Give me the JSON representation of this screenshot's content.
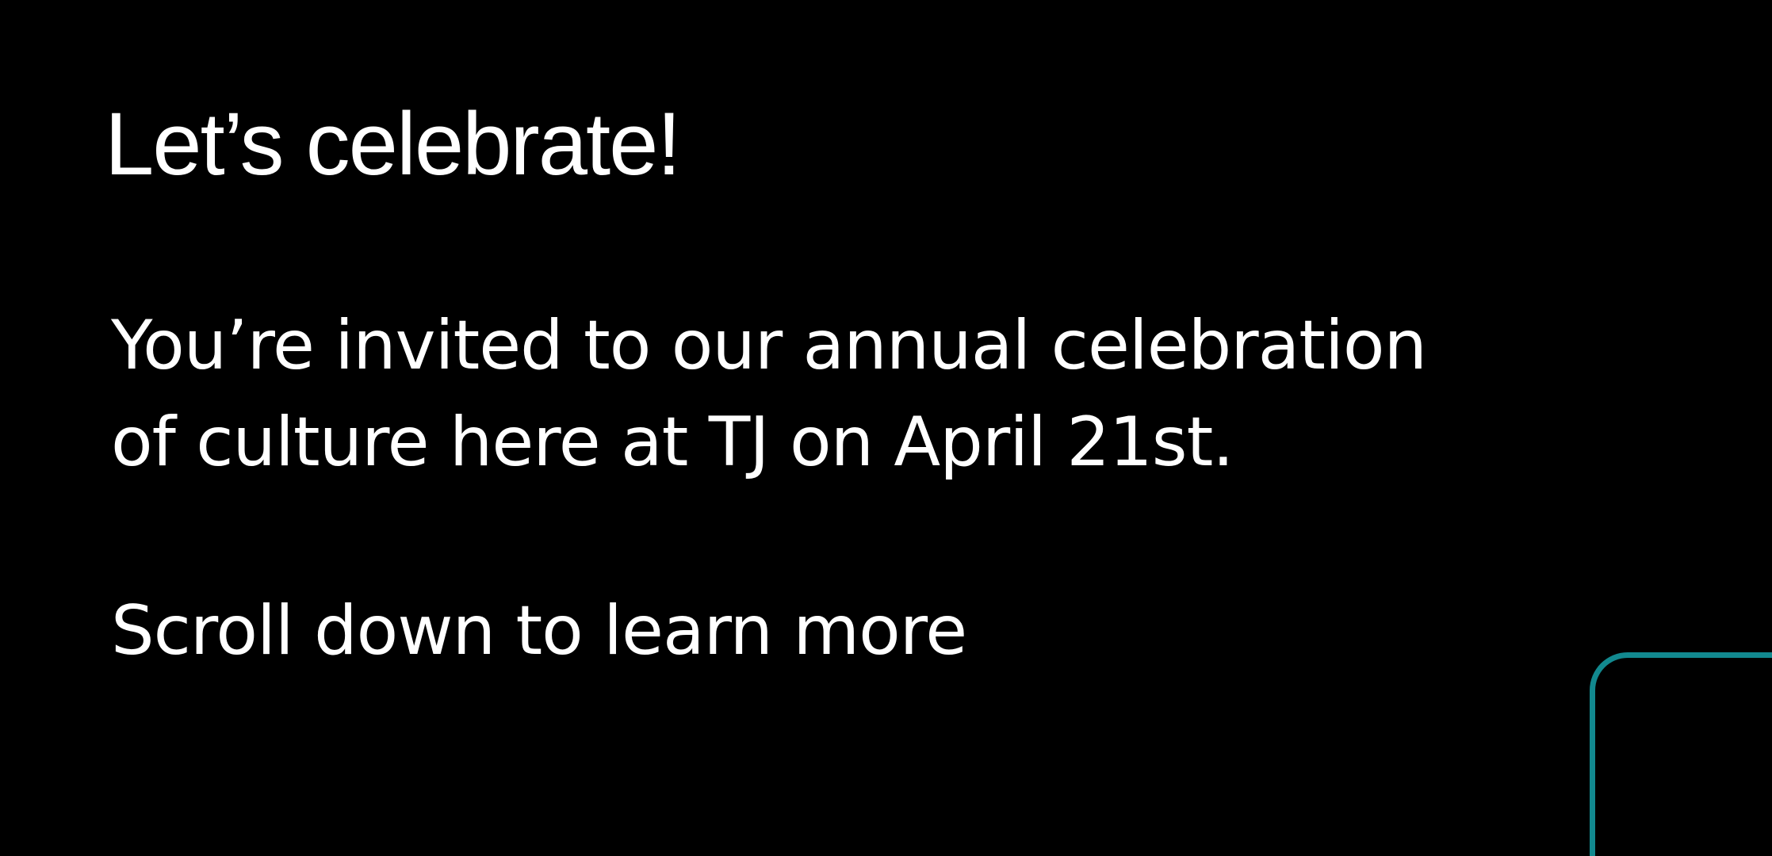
{
  "hero": {
    "title": "Let’s celebrate!",
    "body_line_1": "You’re invited to our annual celebration",
    "body_line_2": "of culture here at TJ on April 21st.",
    "scroll_hint": "Scroll down to learn more"
  },
  "colors": {
    "background": "#000000",
    "text": "#ffffff",
    "accent": "#12898f"
  }
}
